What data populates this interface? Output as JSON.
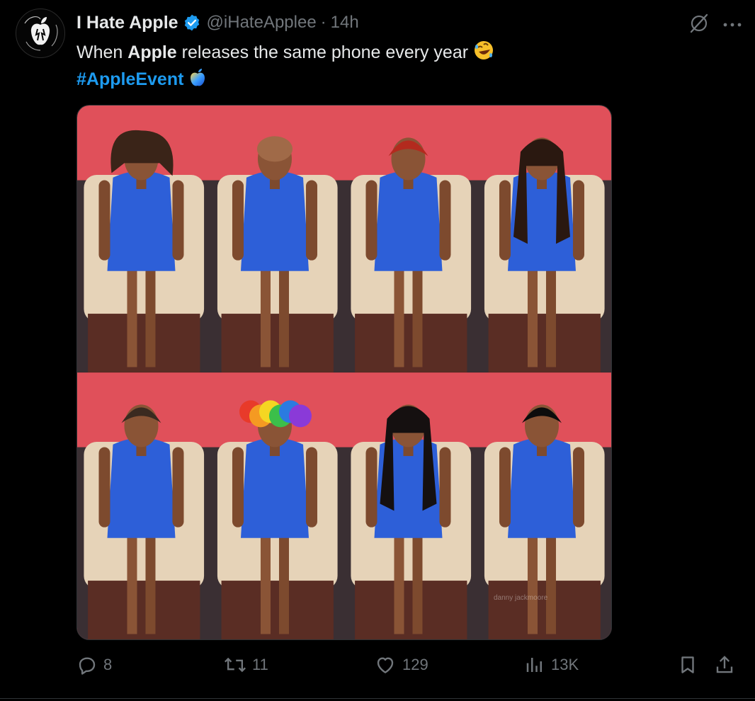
{
  "tweet": {
    "author_name": "I Hate Apple",
    "handle": "@iHateApplee",
    "separator": "·",
    "time": "14h",
    "text_before": "When ",
    "text_bold": "Apple",
    "text_after": " releases the same phone every year",
    "hashtag": "#AppleEvent",
    "image_watermark": "danny jackmoore"
  },
  "actions": {
    "replies": "8",
    "reposts": "11",
    "likes": "129",
    "views": "13K"
  },
  "icons": {
    "verified": "verified-badge-icon",
    "grok": "grok-icon",
    "more": "more-icon",
    "reply": "reply-icon",
    "repost": "repost-icon",
    "like": "like-icon",
    "views": "views-icon",
    "bookmark": "bookmark-icon",
    "share": "share-icon"
  },
  "colors": {
    "background": "#000000",
    "text": "#e7e9ea",
    "muted": "#71767b",
    "accent": "#1d9bf0",
    "photo_wall": "#e0505a",
    "dress": "#2d5fd8"
  }
}
